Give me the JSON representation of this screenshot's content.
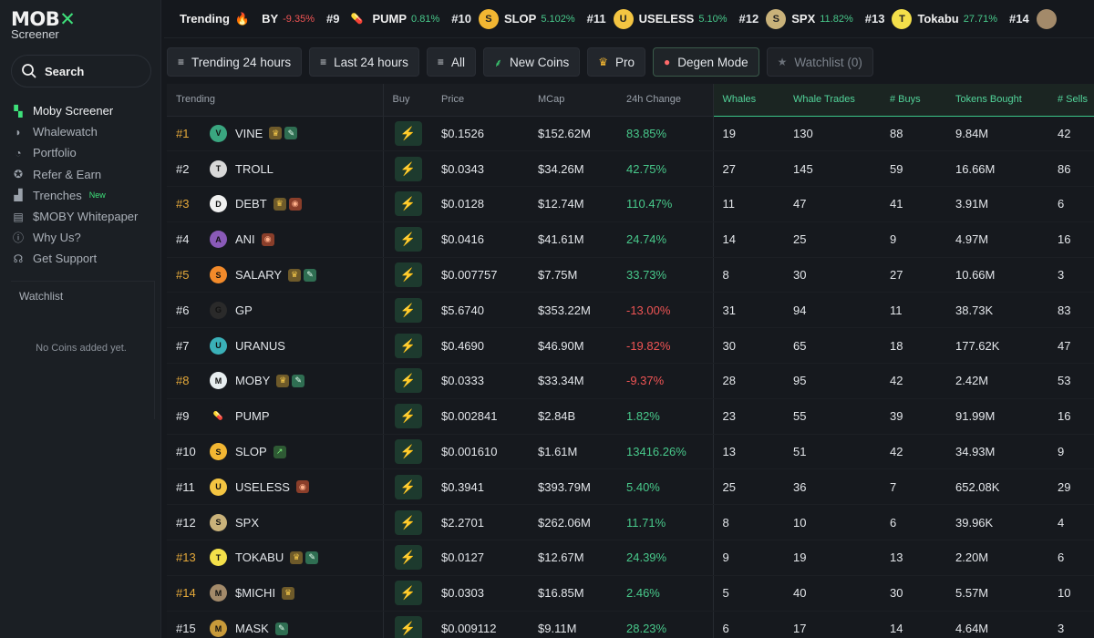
{
  "brand": {
    "logo_text_a": "MOB",
    "logo_text_b": "Screener"
  },
  "sidebar": {
    "search_label": "Search",
    "items": [
      {
        "label": "Moby Screener",
        "icon": "moby-logo-icon",
        "glyph": "▚",
        "active": true
      },
      {
        "label": "Whalewatch",
        "icon": "whale-icon",
        "glyph": "◗",
        "active": false
      },
      {
        "label": "Portfolio",
        "icon": "pie-chart-icon",
        "glyph": "◔",
        "active": false
      },
      {
        "label": "Refer & Earn",
        "icon": "medal-icon",
        "glyph": "✪",
        "active": false
      },
      {
        "label": "Trenches",
        "icon": "trenches-icon",
        "glyph": "▟",
        "active": false,
        "badge": "New"
      },
      {
        "label": "$MOBY Whitepaper",
        "icon": "book-icon",
        "glyph": "▤",
        "active": false
      },
      {
        "label": "Why Us?",
        "icon": "info-icon",
        "glyph": "ⓘ",
        "active": false
      },
      {
        "label": "Get Support",
        "icon": "headset-icon",
        "glyph": "☊",
        "active": false
      }
    ],
    "watchlist_title": "Watchlist",
    "watchlist_empty": "No Coins added yet."
  },
  "ticker": {
    "label": "Trending",
    "items": [
      {
        "rank": "",
        "symbol": "BY",
        "pct": "-9.35%",
        "dir": "down",
        "color": "",
        "glyph": ""
      },
      {
        "rank": "#9",
        "symbol": "PUMP",
        "pct": "0.81%",
        "dir": "up",
        "color": "#ffffff",
        "glyph": "💊"
      },
      {
        "rank": "#10",
        "symbol": "SLOP",
        "pct": "5.102%",
        "dir": "up",
        "color": "#f2b632",
        "glyph": "S"
      },
      {
        "rank": "#11",
        "symbol": "USELESS",
        "pct": "5.10%",
        "dir": "up",
        "color": "#f4c542",
        "glyph": "U"
      },
      {
        "rank": "#12",
        "symbol": "SPX",
        "pct": "11.82%",
        "dir": "up",
        "color": "#c9b27a",
        "glyph": "S"
      },
      {
        "rank": "#13",
        "symbol": "Tokabu",
        "pct": "27.71%",
        "dir": "up",
        "color": "#f4e04a",
        "glyph": "T"
      },
      {
        "rank": "#14",
        "symbol": "",
        "pct": "",
        "dir": "up",
        "color": "#a38a6a",
        "glyph": ""
      }
    ]
  },
  "filters": [
    {
      "label": "Trending 24 hours",
      "icon": "sort-icon",
      "glyph": "≡",
      "cls": ""
    },
    {
      "label": "Last 24 hours",
      "icon": "sort-icon",
      "glyph": "≡",
      "cls": ""
    },
    {
      "label": "All",
      "icon": "sort-icon",
      "glyph": "≡",
      "cls": ""
    },
    {
      "label": "New Coins",
      "icon": "sprout-icon",
      "glyph": "⸙",
      "cls": "newc"
    },
    {
      "label": "Pro",
      "icon": "crown-icon",
      "glyph": "♛",
      "cls": "pro"
    },
    {
      "label": "Degen Mode",
      "icon": "degen-icon",
      "glyph": "●",
      "cls": "degen"
    },
    {
      "label": "Watchlist (0)",
      "icon": "star-icon",
      "glyph": "★",
      "cls": "watch"
    }
  ],
  "table": {
    "headers": [
      "Trending",
      "Buy",
      "Price",
      "MCap",
      "24h Change",
      "Whales",
      "Whale Trades",
      "# Buys",
      "Tokens Bought",
      "# Sells"
    ],
    "rows": [
      {
        "rank": "#1",
        "gold": true,
        "name": "VINE",
        "color": "#3aa680",
        "glyph": "V",
        "badges": [
          "crown",
          "pill"
        ],
        "price": "$0.1526",
        "mcap": "$152.62M",
        "change": "83.85%",
        "dir": "up",
        "whales": "19",
        "whale_trades": "130",
        "buys": "88",
        "tokens": "9.84M",
        "sells": "42"
      },
      {
        "rank": "#2",
        "gold": false,
        "name": "TROLL",
        "color": "#d8d8d8",
        "glyph": "T",
        "badges": [],
        "price": "$0.0343",
        "mcap": "$34.26M",
        "change": "42.75%",
        "dir": "up",
        "whales": "27",
        "whale_trades": "145",
        "buys": "59",
        "tokens": "16.66M",
        "sells": "86"
      },
      {
        "rank": "#3",
        "gold": true,
        "name": "DEBT",
        "color": "#f0f0f0",
        "glyph": "D",
        "badges": [
          "crown",
          "fire"
        ],
        "price": "$0.0128",
        "mcap": "$12.74M",
        "change": "110.47%",
        "dir": "up",
        "whales": "11",
        "whale_trades": "47",
        "buys": "41",
        "tokens": "3.91M",
        "sells": "6"
      },
      {
        "rank": "#4",
        "gold": false,
        "name": "ANI",
        "color": "#8a5ab8",
        "glyph": "A",
        "badges": [
          "fire"
        ],
        "price": "$0.0416",
        "mcap": "$41.61M",
        "change": "24.74%",
        "dir": "up",
        "whales": "14",
        "whale_trades": "25",
        "buys": "9",
        "tokens": "4.97M",
        "sells": "16"
      },
      {
        "rank": "#5",
        "gold": true,
        "name": "SALARY",
        "color": "#f28a2a",
        "glyph": "S",
        "badges": [
          "crown",
          "pill"
        ],
        "price": "$0.007757",
        "mcap": "$7.75M",
        "change": "33.73%",
        "dir": "up",
        "whales": "8",
        "whale_trades": "30",
        "buys": "27",
        "tokens": "10.66M",
        "sells": "3"
      },
      {
        "rank": "#6",
        "gold": false,
        "name": "GP",
        "color": "#2a2a2a",
        "glyph": "G",
        "badges": [],
        "price": "$5.6740",
        "mcap": "$353.22M",
        "change": "-13.00%",
        "dir": "down",
        "whales": "31",
        "whale_trades": "94",
        "buys": "11",
        "tokens": "38.73K",
        "sells": "83"
      },
      {
        "rank": "#7",
        "gold": false,
        "name": "URANUS",
        "color": "#3ab0b8",
        "glyph": "U",
        "badges": [],
        "price": "$0.4690",
        "mcap": "$46.90M",
        "change": "-19.82%",
        "dir": "down",
        "whales": "30",
        "whale_trades": "65",
        "buys": "18",
        "tokens": "177.62K",
        "sells": "47"
      },
      {
        "rank": "#8",
        "gold": true,
        "name": "MOBY",
        "color": "#e8eef0",
        "glyph": "M",
        "badges": [
          "crown",
          "pill"
        ],
        "price": "$0.0333",
        "mcap": "$33.34M",
        "change": "-9.37%",
        "dir": "down",
        "whales": "28",
        "whale_trades": "95",
        "buys": "42",
        "tokens": "2.42M",
        "sells": "53"
      },
      {
        "rank": "#9",
        "gold": false,
        "name": "PUMP",
        "color": "#16191e",
        "glyph": "💊",
        "badges": [],
        "price": "$0.002841",
        "mcap": "$2.84B",
        "change": "1.82%",
        "dir": "up",
        "whales": "23",
        "whale_trades": "55",
        "buys": "39",
        "tokens": "91.99M",
        "sells": "16"
      },
      {
        "rank": "#10",
        "gold": false,
        "name": "SLOP",
        "color": "#f2b632",
        "glyph": "S",
        "badges": [
          "up"
        ],
        "price": "$0.001610",
        "mcap": "$1.61M",
        "change": "13416.26%",
        "dir": "up",
        "whales": "13",
        "whale_trades": "51",
        "buys": "42",
        "tokens": "34.93M",
        "sells": "9"
      },
      {
        "rank": "#11",
        "gold": false,
        "name": "USELESS",
        "color": "#f4c542",
        "glyph": "U",
        "badges": [
          "fire"
        ],
        "price": "$0.3941",
        "mcap": "$393.79M",
        "change": "5.40%",
        "dir": "up",
        "whales": "25",
        "whale_trades": "36",
        "buys": "7",
        "tokens": "652.08K",
        "sells": "29"
      },
      {
        "rank": "#12",
        "gold": false,
        "name": "SPX",
        "color": "#c9b27a",
        "glyph": "S",
        "badges": [],
        "price": "$2.2701",
        "mcap": "$262.06M",
        "change": "11.71%",
        "dir": "up",
        "whales": "8",
        "whale_trades": "10",
        "buys": "6",
        "tokens": "39.96K",
        "sells": "4"
      },
      {
        "rank": "#13",
        "gold": true,
        "name": "TOKABU",
        "color": "#f4e04a",
        "glyph": "T",
        "badges": [
          "crown",
          "pill"
        ],
        "price": "$0.0127",
        "mcap": "$12.67M",
        "change": "24.39%",
        "dir": "up",
        "whales": "9",
        "whale_trades": "19",
        "buys": "13",
        "tokens": "2.20M",
        "sells": "6"
      },
      {
        "rank": "#14",
        "gold": true,
        "name": "$MICHI",
        "color": "#a38a6a",
        "glyph": "M",
        "badges": [
          "crown"
        ],
        "price": "$0.0303",
        "mcap": "$16.85M",
        "change": "2.46%",
        "dir": "up",
        "whales": "5",
        "whale_trades": "40",
        "buys": "30",
        "tokens": "5.57M",
        "sells": "10"
      },
      {
        "rank": "#15",
        "gold": false,
        "name": "MASK",
        "color": "#c89a3a",
        "glyph": "M",
        "badges": [
          "pill"
        ],
        "price": "$0.009112",
        "mcap": "$9.11M",
        "change": "28.23%",
        "dir": "up",
        "whales": "6",
        "whale_trades": "17",
        "buys": "14",
        "tokens": "4.64M",
        "sells": "3"
      }
    ]
  },
  "colors": {
    "accent": "#3ee07a",
    "up": "#48c98b",
    "down": "#ef5454",
    "gold": "#e5a93a",
    "background": "#15181d"
  }
}
